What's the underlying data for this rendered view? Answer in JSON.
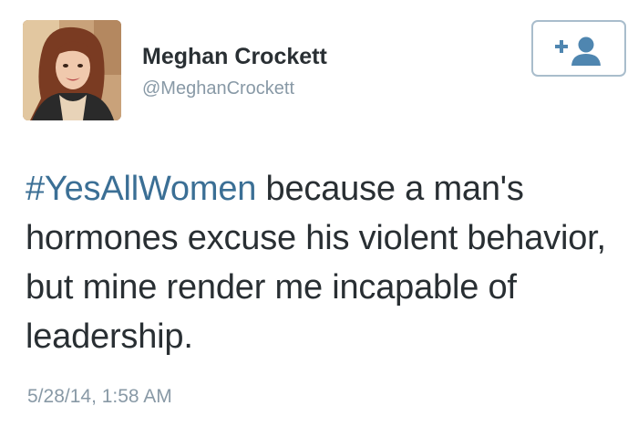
{
  "tweet": {
    "author": {
      "name": "Meghan Crockett",
      "handle": "@MeghanCrockett",
      "avatar_icon": "profile-photo"
    },
    "follow_button": {
      "icon": "follow-user-icon",
      "label": "+"
    },
    "text": {
      "hashtag": "#YesAllWomen",
      "body": " because a man's hormones excuse his violent behavior, but mine render me incapable of leadership."
    },
    "timestamp": "5/28/14, 1:58 AM"
  },
  "colors": {
    "hashtag": "#3b6f95",
    "text": "#292f33",
    "secondary": "#8899a6",
    "follow_border": "#a9bdcc",
    "follow_icon": "#4f86b0"
  }
}
